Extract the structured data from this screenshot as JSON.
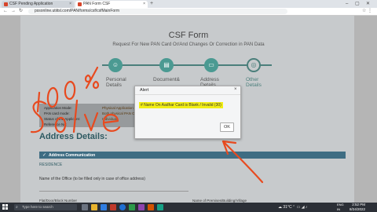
{
  "browser": {
    "tabs": [
      {
        "label": "CSF Pending Application",
        "active": false
      },
      {
        "label": "PAN Form CSF",
        "active": true
      }
    ],
    "new_tab": "+",
    "url": "pssonline.utiitsl.com/PAN/forms/csf/csfMainForm"
  },
  "page": {
    "title": "CSF Form",
    "subtitle": "Request For New PAN Card Or/And Changes Or Correction in PAN Data",
    "steps": [
      {
        "label_line1": "Personal",
        "label_line2": "Details",
        "status": "done"
      },
      {
        "label_line1": "Document&",
        "label_line2": "",
        "status": "done"
      },
      {
        "label_line1": "Address",
        "label_line2": "Details",
        "status": "done"
      },
      {
        "label_line1": "Other",
        "label_line2": "Details",
        "status": "active"
      }
    ],
    "details": [
      {
        "label": "Application Mode:",
        "value": "Physical Application"
      },
      {
        "label": "PAN card mode:",
        "value": "Both physical PAN C"
      },
      {
        "label": "Status of the Applicant:",
        "value": "Individual"
      },
      {
        "label": "Reference No:",
        "value": ""
      }
    ],
    "address_heading": "Address Details:",
    "address_section_title": "Address Communication",
    "residence_label": "RESIDENCE",
    "office_label": "Name of the Office (to be filled only in case of office address)",
    "bottom_left_label": "Flat/Door/Block Number",
    "bottom_right_label": "Name of Premises/Building/Village"
  },
  "dialog": {
    "title": "Alert",
    "close": "×",
    "message": "# Name On Aadhar Card is Blank / Invalid (30)",
    "ok_label": "OK"
  },
  "annotation": {
    "text_line1": "100%",
    "text_line2": "Solve",
    "color": "#e84a1f"
  },
  "taskbar": {
    "search_placeholder": "Type here to search",
    "weather": "31°C",
    "time": "2:52 PM",
    "date": "8/24/2022",
    "lang_line1": "ENG",
    "lang_line2": "IN"
  },
  "colors": {
    "accent": "#3f6d83",
    "step_done": "#4b9a92",
    "highlight": "#f2ee15"
  }
}
